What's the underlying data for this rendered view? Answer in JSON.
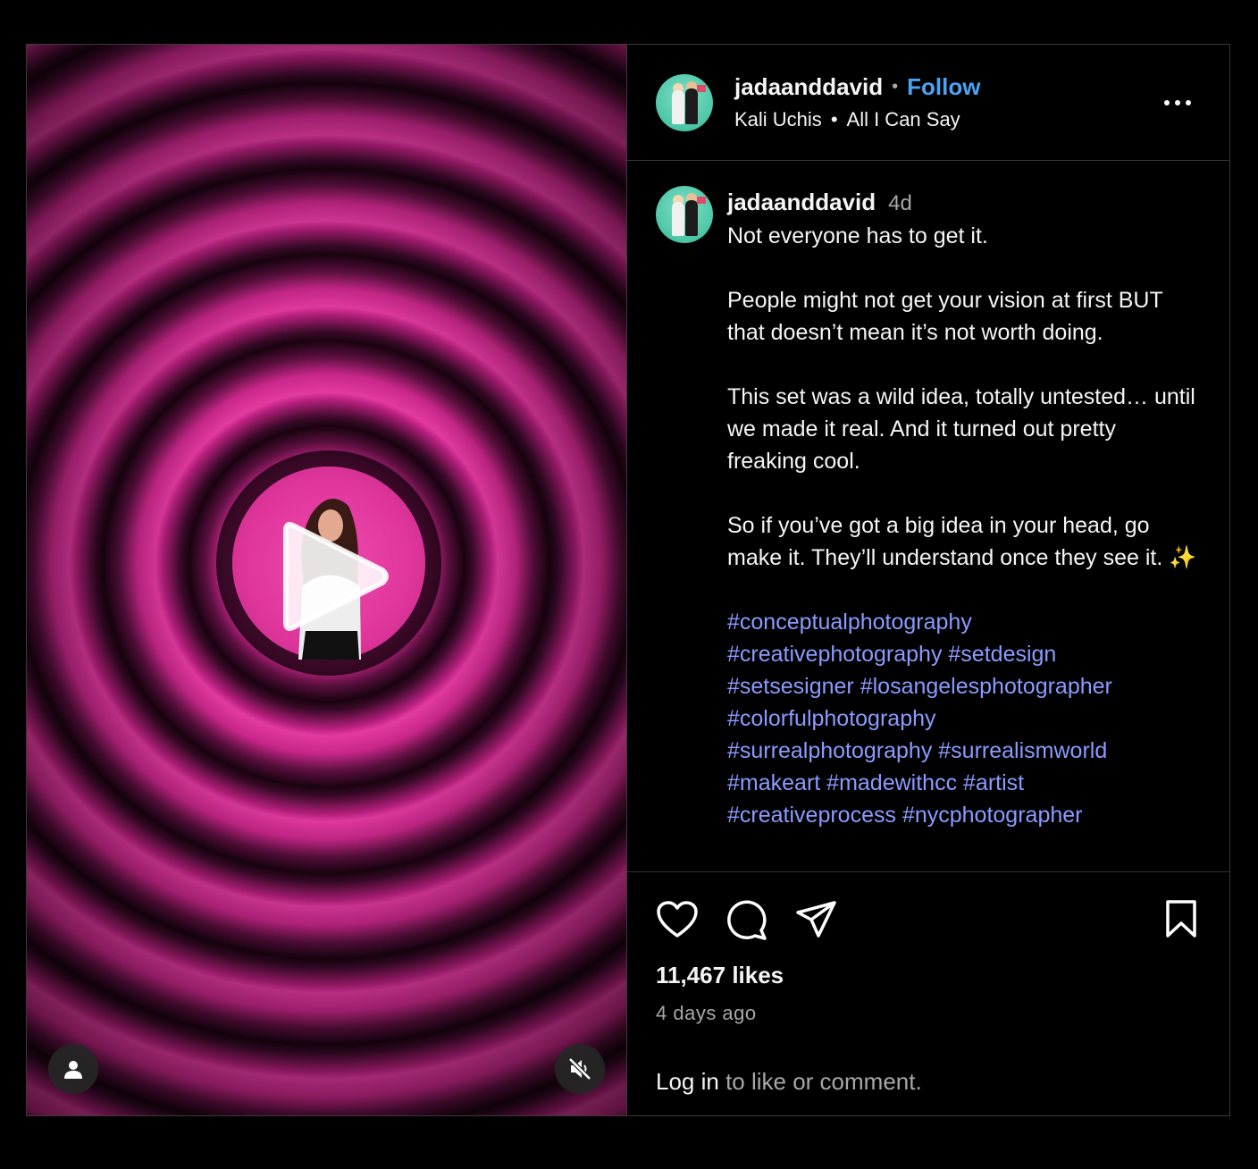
{
  "post": {
    "username": "jadaanddavid",
    "follow_label": "Follow",
    "audio_artist": "Kali Uchis",
    "audio_track": "All I Can Say",
    "separator_dot": "•",
    "audio_separator": "•"
  },
  "caption": {
    "username": "jadaanddavid",
    "time": "4d",
    "text": "Not everyone has to get it.\n\nPeople might not get your vision at first BUT that doesn’t mean it’s not worth doing.\n\nThis set was a wild idea, totally untested… until we made it real. And it turned out pretty freaking cool.\n\nSo if you’ve got a big idea in your head, go make it. They’ll understand once they see it. ✨\n\n",
    "hashtags": [
      "#conceptualphotography",
      "#creativephotography",
      "#setdesign",
      "#setsesigner",
      "#losangelesphotographer",
      "#colorfulphotography",
      "#surrealphotography",
      "#surrealismworld",
      "#makeart",
      "#madewithcc",
      "#artist",
      "#creativeprocess",
      "#nycphotographer"
    ]
  },
  "engagement": {
    "likes": "11,467 likes",
    "time_ago": "4 days ago"
  },
  "login_prompt": {
    "link": "Log in",
    "rest": " to like or comment."
  },
  "colors": {
    "follow": "#4aa3f5",
    "hashtag": "#8a9bff",
    "accent_pink": "#e33aa0"
  }
}
